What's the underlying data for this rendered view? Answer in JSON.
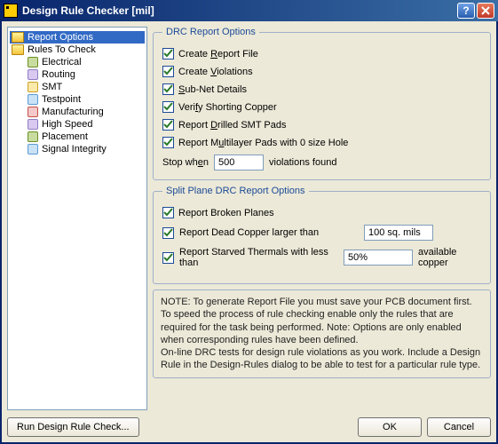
{
  "window": {
    "title": "Design Rule Checker [mil]"
  },
  "tree": {
    "items": [
      {
        "label": "Report Options",
        "type": "folder",
        "selected": true
      },
      {
        "label": "Rules To Check",
        "type": "folder"
      },
      {
        "label": "Electrical",
        "type": "leaf",
        "iconClass": ""
      },
      {
        "label": "Routing",
        "type": "leaf",
        "iconClass": "b"
      },
      {
        "label": "SMT",
        "type": "leaf",
        "iconClass": "c"
      },
      {
        "label": "Testpoint",
        "type": "leaf",
        "iconClass": "d"
      },
      {
        "label": "Manufacturing",
        "type": "leaf",
        "iconClass": "e"
      },
      {
        "label": "High Speed",
        "type": "leaf",
        "iconClass": "b"
      },
      {
        "label": "Placement",
        "type": "leaf",
        "iconClass": ""
      },
      {
        "label": "Signal Integrity",
        "type": "leaf",
        "iconClass": "d"
      }
    ]
  },
  "groups": {
    "drc": {
      "legend": "DRC Report Options",
      "create_report": "Create Report File",
      "create_violations": "Create Violations",
      "subnet": "Sub-Net Details",
      "verify_shorting": "Verify Shorting Copper",
      "report_drilled": "Report Drilled SMT Pads",
      "report_multilayer": "Report Multilayer Pads with 0 size Hole",
      "stop_prefix": "Stop when",
      "stop_value": "500",
      "stop_suffix": "violations found"
    },
    "split": {
      "legend": "Split Plane DRC Report Options",
      "broken": "Report Broken Planes",
      "dead_copper": "Report Dead Copper larger than",
      "dead_copper_value": "100 sq. mils",
      "starved": "Report Starved Thermals with less than",
      "starved_value": "50%",
      "starved_suffix": "available copper"
    }
  },
  "note": {
    "line1": "NOTE: To generate Report File you must save your PCB document first.",
    "line2": "To speed the process of rule checking enable only the rules that are required for the task being performed.  Note: Options are only enabled when corresponding rules have been defined.",
    "line3": "On-line DRC tests for design rule violations as you work. Include a Design Rule in the Design-Rules dialog to be able to test for a particular rule  type."
  },
  "buttons": {
    "run": "Run Design Rule Check...",
    "ok": "OK",
    "cancel": "Cancel"
  }
}
